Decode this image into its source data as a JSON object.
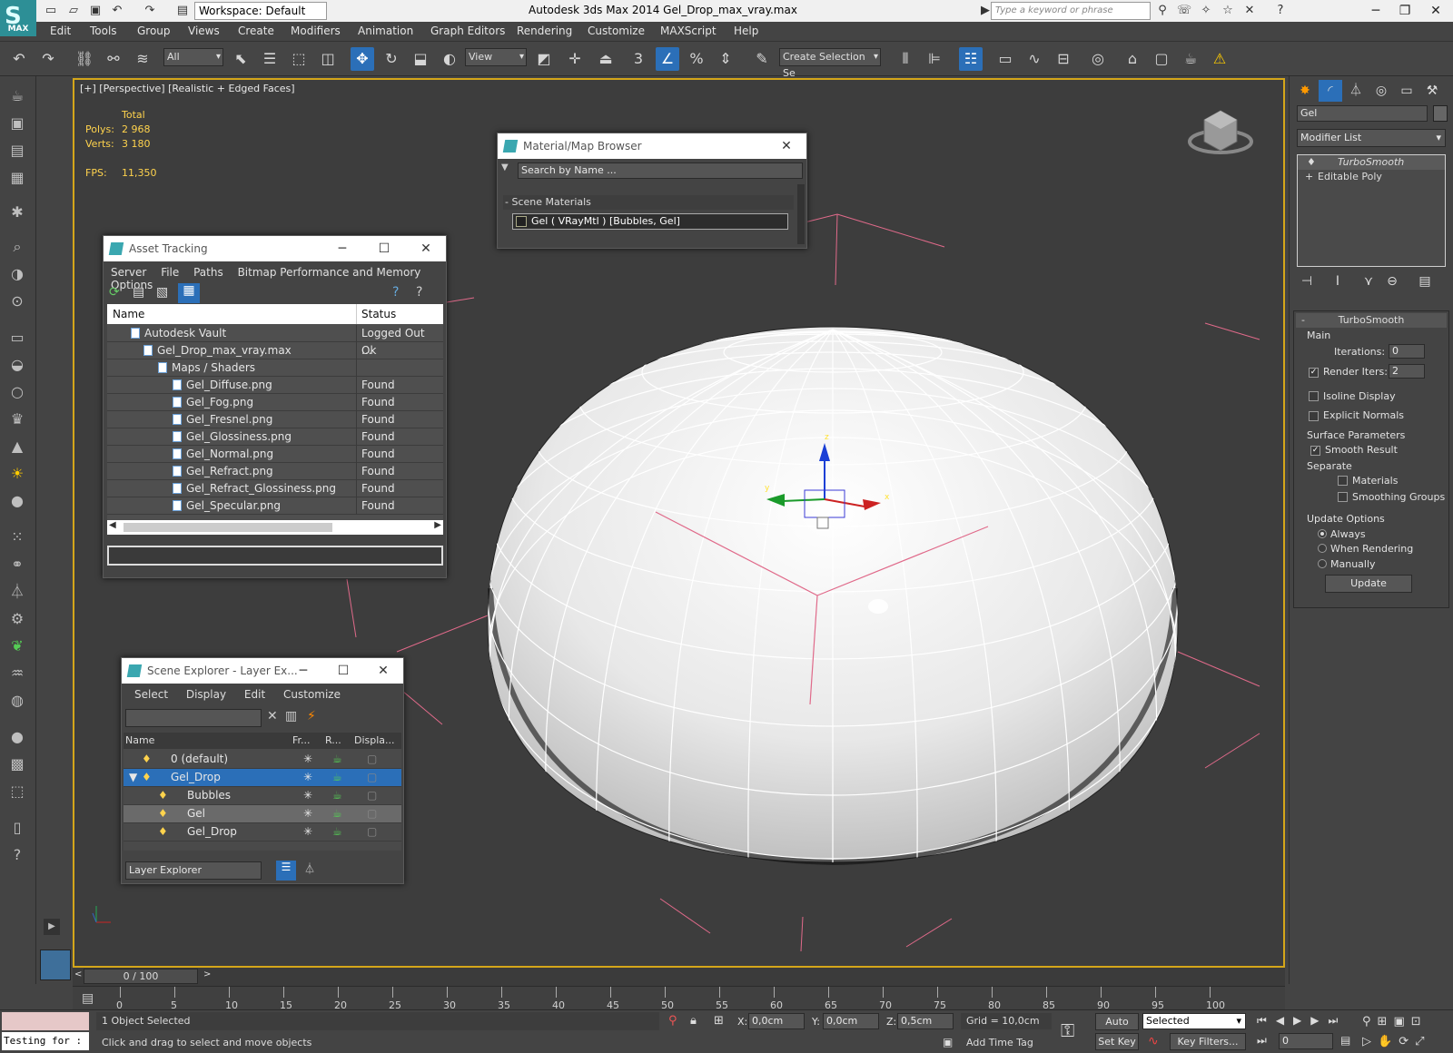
{
  "app": {
    "title": "Autodesk 3ds Max  2014     Gel_Drop_max_vray.max",
    "workspace": "Workspace: Default",
    "help_search_placeholder": "Type a keyword or phrase",
    "logo_text": "MAX"
  },
  "menu": [
    "Edit",
    "Tools",
    "Group",
    "Views",
    "Create",
    "Modifiers",
    "Animation",
    "Graph Editors",
    "Rendering",
    "Customize",
    "MAXScript",
    "Help"
  ],
  "toolbar": {
    "selection_filter": "All",
    "ref_coord": "View",
    "named_selection": "Create Selection Se",
    "snap_3": "3",
    "percent": "%"
  },
  "viewport": {
    "label": "[+] [Perspective] [Realistic + Edged Faces]",
    "stats": {
      "total_label": "Total",
      "polys_label": "Polys:",
      "polys": "2 968",
      "verts_label": "Verts:",
      "verts": "3 180",
      "fps_label": "FPS:",
      "fps": "11,350"
    },
    "gizmo": {
      "x": "x",
      "y": "y",
      "z": "z"
    }
  },
  "material_browser": {
    "title": "Material/Map Browser",
    "search_placeholder": "Search by Name ...",
    "group": "- Scene Materials",
    "item": "Gel  ( VRayMtl )  [Bubbles, Gel]"
  },
  "asset_tracking": {
    "title": "Asset Tracking",
    "menus": [
      "Server",
      "File",
      "Paths",
      "Bitmap Performance and Memory",
      "Options"
    ],
    "columns": [
      "Name",
      "Status"
    ],
    "rows": [
      {
        "name": "Autodesk Vault",
        "status": "Logged Out ..."
      },
      {
        "name": "Gel_Drop_max_vray.max",
        "status": "Ok"
      },
      {
        "name": "Maps / Shaders",
        "status": ""
      },
      {
        "name": "Gel_Diffuse.png",
        "status": "Found"
      },
      {
        "name": "Gel_Fog.png",
        "status": "Found"
      },
      {
        "name": "Gel_Fresnel.png",
        "status": "Found"
      },
      {
        "name": "Gel_Glossiness.png",
        "status": "Found"
      },
      {
        "name": "Gel_Normal.png",
        "status": "Found"
      },
      {
        "name": "Gel_Refract.png",
        "status": "Found"
      },
      {
        "name": "Gel_Refract_Glossiness.png",
        "status": "Found"
      },
      {
        "name": "Gel_Specular.png",
        "status": "Found"
      }
    ]
  },
  "scene_explorer": {
    "title": "Scene Explorer - Layer Ex...",
    "menus": [
      "Select",
      "Display",
      "Edit",
      "Customize"
    ],
    "columns": [
      "Name",
      "Fr...",
      "R...",
      "Displa..."
    ],
    "rows": [
      {
        "name": "0 (default)"
      },
      {
        "name": "Gel_Drop"
      },
      {
        "name": "Bubbles"
      },
      {
        "name": "Gel"
      },
      {
        "name": "Gel_Drop"
      }
    ],
    "footer_dropdown": "Layer Explorer"
  },
  "command_panel": {
    "object_name": "Gel",
    "modifier_list": "Modifier List",
    "stack": [
      "TurboSmooth",
      "Editable Poly"
    ],
    "rollout_title": "TurboSmooth",
    "main_label": "Main",
    "iterations_label": "Iterations:",
    "iterations": "0",
    "render_iters_label": "Render Iters:",
    "render_iters": "2",
    "isoline_label": "Isoline Display",
    "explicit_normals_label": "Explicit Normals",
    "surface_params_label": "Surface Parameters",
    "smooth_result_label": "Smooth Result",
    "separate_label": "Separate",
    "materials_label": "Materials",
    "smoothing_groups_label": "Smoothing Groups",
    "update_options_label": "Update Options",
    "always_label": "Always",
    "when_rendering_label": "When Rendering",
    "manually_label": "Manually",
    "update_button": "Update"
  },
  "timeline": {
    "frame": "0 / 100",
    "ticks": [
      "0",
      "5",
      "10",
      "15",
      "20",
      "25",
      "30",
      "35",
      "40",
      "45",
      "50",
      "55",
      "60",
      "65",
      "70",
      "75",
      "80",
      "85",
      "90",
      "95",
      "100"
    ]
  },
  "status": {
    "script_listener": "Testing for :",
    "selection": "1 Object Selected",
    "prompt": "Click and drag to select and move objects",
    "x_label": "X:",
    "x": "0,0cm",
    "y_label": "Y:",
    "y": "0,0cm",
    "z_label": "Z:",
    "z": "0,5cm",
    "grid": "Grid = 10,0cm",
    "auto_key": "Auto Key",
    "set_key": "Set Key",
    "key_mode": "Selected",
    "key_filters": "Key Filters...",
    "add_time_tag": "Add Time Tag",
    "current_frame": "0"
  }
}
